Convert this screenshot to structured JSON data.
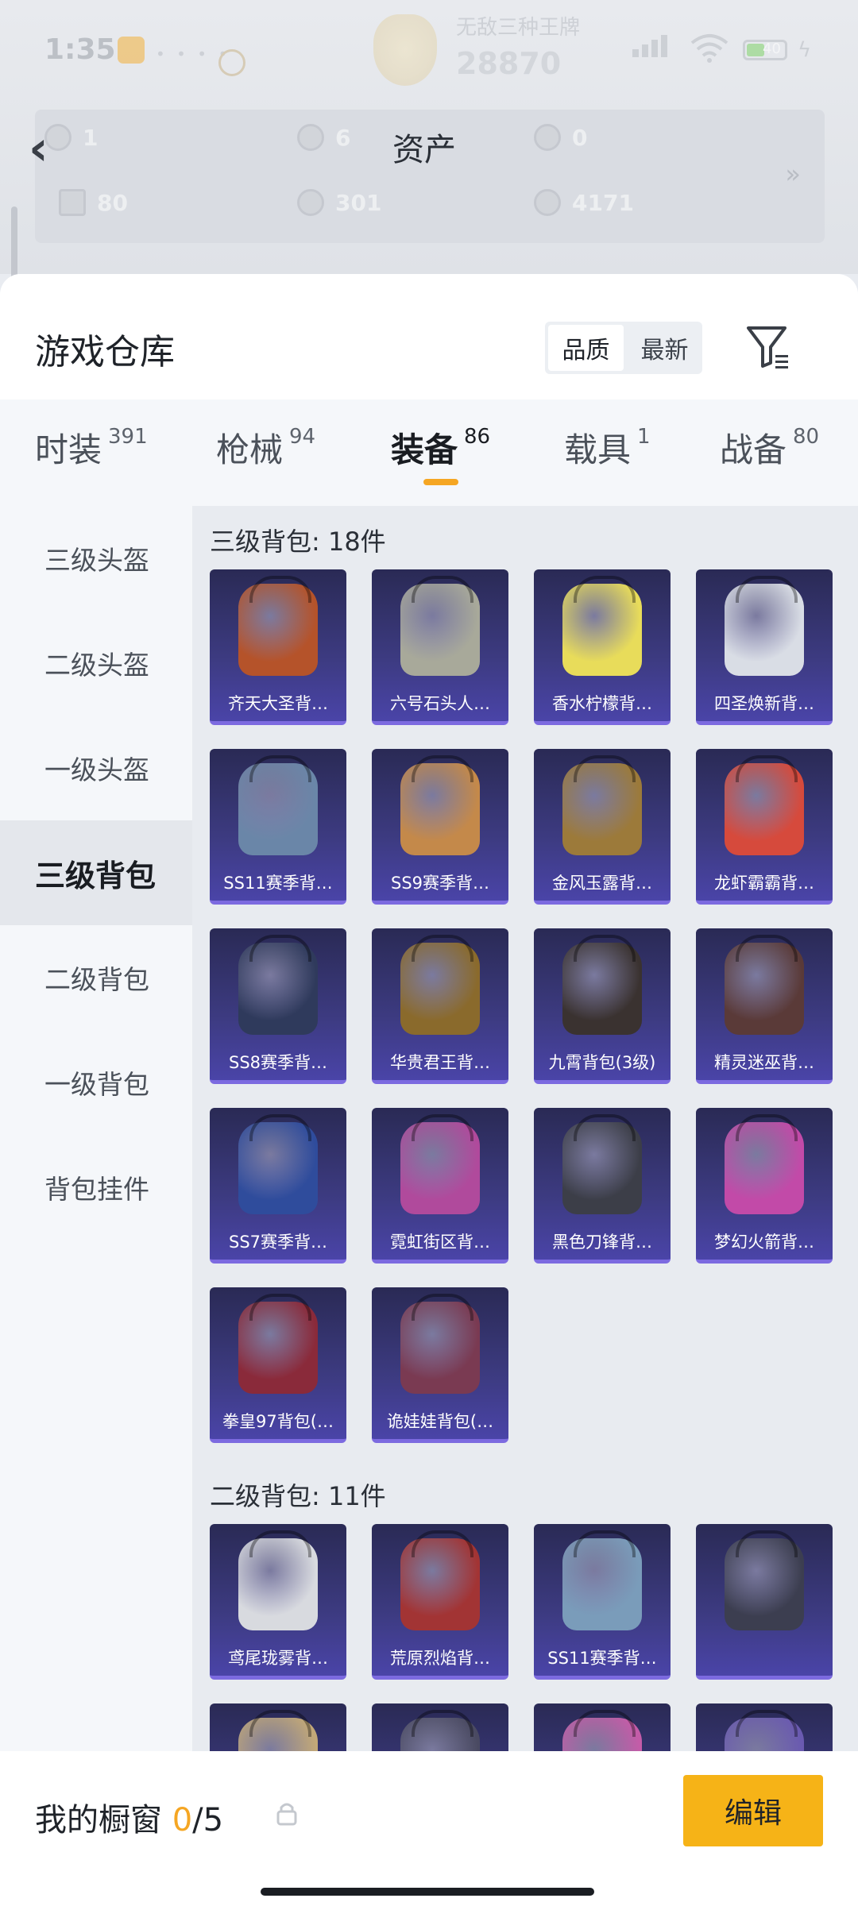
{
  "status": {
    "time": "1:35",
    "rank_name": "无敌三种王牌",
    "rank_score": "28870",
    "battery": "40"
  },
  "assets": {
    "title": "资产",
    "more": "»",
    "values": [
      "1",
      "6",
      "0",
      "80",
      "301",
      "4171"
    ]
  },
  "warehouse": {
    "title": "游戏仓库",
    "sort_options": [
      "品质",
      "最新"
    ],
    "active_sort": "品质"
  },
  "tabs": [
    {
      "name": "时装",
      "count": "391"
    },
    {
      "name": "枪械",
      "count": "94"
    },
    {
      "name": "装备",
      "count": "86"
    },
    {
      "name": "载具",
      "count": "1"
    },
    {
      "name": "战备",
      "count": "80"
    }
  ],
  "active_tab": "装备",
  "sidebar": [
    {
      "label": "三级头盔"
    },
    {
      "label": "二级头盔"
    },
    {
      "label": "一级头盔"
    },
    {
      "label": "三级背包"
    },
    {
      "label": "二级背包"
    },
    {
      "label": "一级背包"
    },
    {
      "label": "背包挂件"
    }
  ],
  "active_sidebar": "三级背包",
  "sections": [
    {
      "title": "三级背包: 18件",
      "items": [
        {
          "name": "齐天大圣背…",
          "color": "#b5532a"
        },
        {
          "name": "六号石头人…",
          "color": "#a8a99a"
        },
        {
          "name": "香水柠檬背…",
          "color": "#e8dc5a"
        },
        {
          "name": "四圣焕新背…",
          "color": "#d9dde5"
        },
        {
          "name": "SS11赛季背…",
          "color": "#6a86a8"
        },
        {
          "name": "SS9赛季背…",
          "color": "#c4894a"
        },
        {
          "name": "金风玉露背…",
          "color": "#9c7a3a"
        },
        {
          "name": "龙虾霸霸背…",
          "color": "#d64a3c"
        },
        {
          "name": "SS8赛季背…",
          "color": "#2f3a5c"
        },
        {
          "name": "华贵君王背…",
          "color": "#8a6a2c"
        },
        {
          "name": "九霄背包(3级)",
          "color": "#3a3230"
        },
        {
          "name": "精灵迷巫背…",
          "color": "#5a3a38"
        },
        {
          "name": "SS7赛季背…",
          "color": "#2f4c9c"
        },
        {
          "name": "霓虹街区背…",
          "color": "#b04a9c"
        },
        {
          "name": "黑色刀锋背…",
          "color": "#3c3e48"
        },
        {
          "name": "梦幻火箭背…",
          "color": "#c24aa8"
        },
        {
          "name": "拳皇97背包(…",
          "color": "#8a2a3a"
        },
        {
          "name": "诡娃娃背包(…",
          "color": "#7a3a52"
        }
      ]
    },
    {
      "title": "二级背包: 11件",
      "items": [
        {
          "name": "鸢尾珑雾背…",
          "color": "#d8dadf"
        },
        {
          "name": "荒原烈焰背…",
          "color": "#a23434"
        },
        {
          "name": "SS11赛季背…",
          "color": "#7a9cba"
        },
        {
          "name": "",
          "color": "#3c3e50"
        },
        {
          "name": "",
          "color": "#c2a878"
        },
        {
          "name": "",
          "color": "#4a4a62"
        },
        {
          "name": "",
          "color": "#c45ca8"
        },
        {
          "name": "",
          "color": "#6a5ab0"
        }
      ]
    }
  ],
  "showcase": {
    "label": "我的橱窗",
    "used": "0",
    "total": "/5",
    "edit_label": "编辑"
  }
}
